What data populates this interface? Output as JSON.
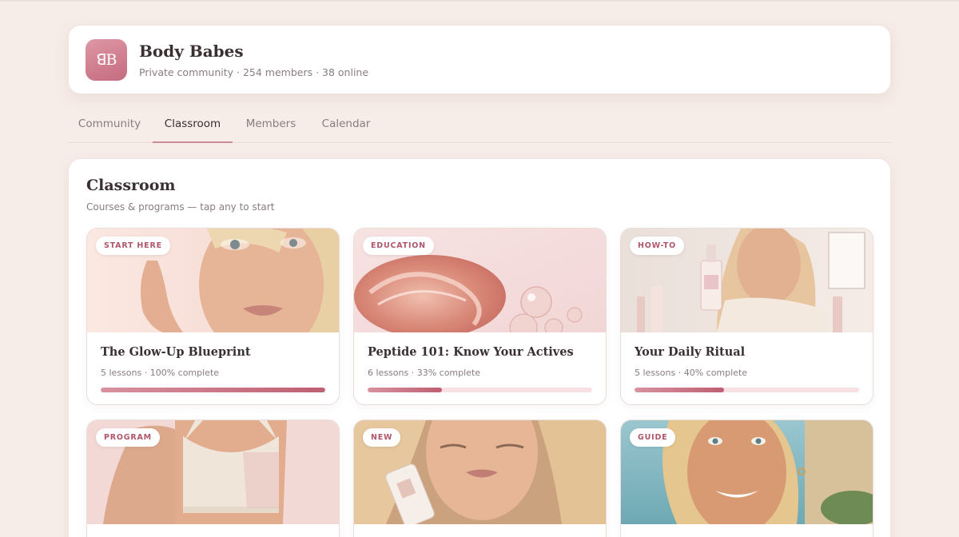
{
  "community": {
    "logo_text": "ꓭB",
    "name": "Body Babes",
    "meta": "Private community · 254 members · 38 online"
  },
  "tabs": [
    {
      "label": "Community",
      "active": false
    },
    {
      "label": "Classroom",
      "active": true
    },
    {
      "label": "Members",
      "active": false
    },
    {
      "label": "Calendar",
      "active": false
    }
  ],
  "classroom": {
    "title": "Classroom",
    "subtitle": "Courses & programs — tap any to start"
  },
  "courses": [
    {
      "badge": "START HERE",
      "title": "The Glow-Up Blueprint",
      "meta": "5 lessons · 100% complete",
      "progress": 1.0,
      "thumb": "portrait-face-icon"
    },
    {
      "badge": "EDUCATION",
      "title": "Peptide 101: Know Your Actives",
      "meta": "6 lessons · 33% complete",
      "progress": 0.33,
      "thumb": "serum-swirl-icon"
    },
    {
      "badge": "HOW-TO",
      "title": "Your Daily Ritual",
      "meta": "5 lessons · 40% complete",
      "progress": 0.4,
      "thumb": "serum-bottle-portrait-icon"
    },
    {
      "badge": "PROGRAM",
      "title": "",
      "meta": "",
      "progress": null,
      "thumb": "fitness-torso-icon"
    },
    {
      "badge": "NEW",
      "title": "",
      "meta": "",
      "progress": null,
      "thumb": "product-portrait-icon"
    },
    {
      "badge": "GUIDE",
      "title": "",
      "meta": "",
      "progress": null,
      "thumb": "beach-portrait-icon"
    }
  ],
  "colors": {
    "accent": "#cf8a98",
    "progress": "#bf5f73",
    "background": "#f6ece8"
  }
}
